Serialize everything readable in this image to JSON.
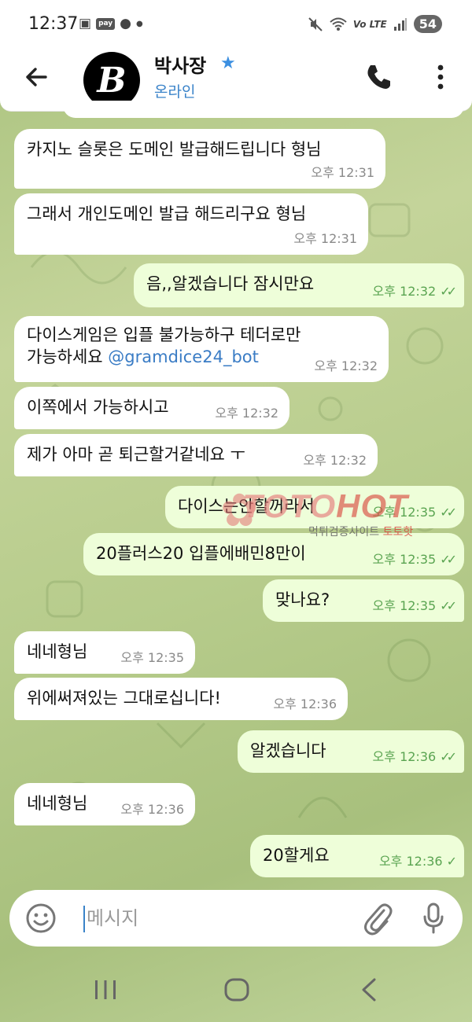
{
  "status_bar": {
    "time": "12:37",
    "pay_badge": "pay",
    "volte": "Vo LTE",
    "battery": "54"
  },
  "header": {
    "name": "박사장",
    "status": "온라인",
    "avatar_letter": "B",
    "accent": "#3a83c9"
  },
  "messages": [
    {
      "dir": "in",
      "text": "카지노 슬롯은 도메인 발급해드립니다 형님",
      "time": "오후 12:31"
    },
    {
      "dir": "in",
      "text": "그래서 개인도메인 발급 해드리구요 형님",
      "time": "오후 12:31"
    },
    {
      "dir": "out",
      "text": "음,,알겠습니다 잠시만요",
      "time": "오후 12:32",
      "read": true
    },
    {
      "dir": "in",
      "text_line1": "다이스게임은 입플 불가능하구 테더로만",
      "text_line2": "가능하세요",
      "mention": "@gramdice24_bot",
      "time": "오후 12:32"
    },
    {
      "dir": "in",
      "text": "이쪽에서 가능하시고",
      "time": "오후 12:32"
    },
    {
      "dir": "in",
      "text": "제가 아마 곧 퇴근할거같네요 ㅜ",
      "time": "오후 12:32"
    },
    {
      "dir": "out",
      "text": "다이스는안할꺼라서",
      "time": "오후 12:35",
      "read": true
    },
    {
      "dir": "out",
      "text": "20플러스20 입플에배민8만이",
      "time": "오후 12:35",
      "read": true
    },
    {
      "dir": "out",
      "text": "맞나요?",
      "time": "오후 12:35",
      "read": true
    },
    {
      "dir": "in",
      "text": "네네형님",
      "time": "오후 12:35"
    },
    {
      "dir": "in",
      "text": "위에써져있는 그대로십니다!",
      "time": "오후 12:36"
    },
    {
      "dir": "out",
      "text": "알겠습니다",
      "time": "오후 12:36",
      "read": true
    },
    {
      "dir": "in",
      "text": "네네형님",
      "time": "오후 12:36"
    },
    {
      "dir": "out",
      "text": "20할게요",
      "time": "오후 12:36",
      "read": false
    }
  ],
  "watermark": {
    "brand_a": "TOTO",
    "brand_b": "HOT",
    "sub_a": "먹튀검증사이트",
    "sub_b": "토토핫"
  },
  "composer": {
    "placeholder": "메시지",
    "value": ""
  },
  "icons": {
    "back": "arrow-left-icon",
    "call": "phone-icon",
    "menu": "more-vertical-icon",
    "emoji": "smiley-icon",
    "attach": "paperclip-icon",
    "mic": "microphone-icon"
  }
}
